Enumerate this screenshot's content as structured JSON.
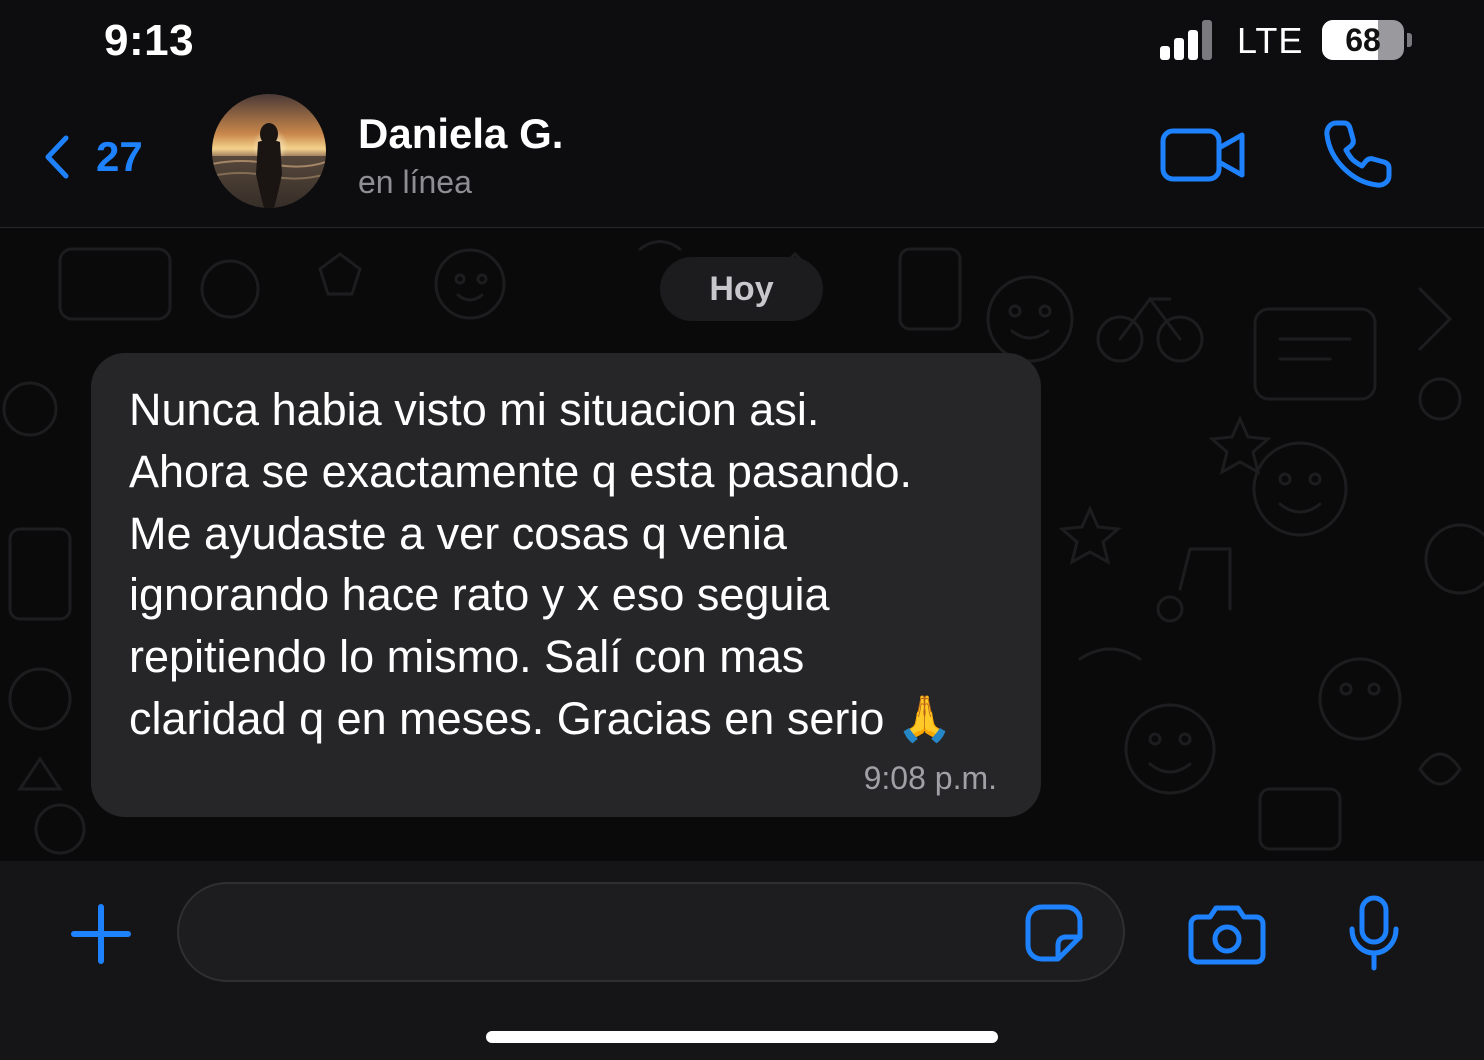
{
  "status_bar": {
    "time": "9:13",
    "network": "LTE",
    "battery": "68",
    "battery_level": 0.68
  },
  "header": {
    "back_count": "27",
    "contact_name": "Daniela G.",
    "contact_status": "en línea",
    "icons": {
      "back": "chevron-left-icon",
      "video": "video-camera-icon",
      "call": "phone-icon"
    }
  },
  "chat": {
    "date_label": "Hoy",
    "message": {
      "lines": [
        "Nunca habia visto mi situacion asi.",
        "Ahora se exactamente q esta pasando.",
        "Me ayudaste a ver cosas q venia",
        "ignorando hace rato y x eso seguia",
        "repitiendo lo mismo. Salí con mas",
        "claridad q en meses. Gracias en serio 🙏"
      ],
      "time": "9:08 p.m."
    }
  },
  "input_bar": {
    "value": "",
    "icons": {
      "attach": "plus-icon",
      "sticker": "sticker-icon",
      "camera": "camera-icon",
      "mic": "microphone-icon"
    }
  },
  "colors": {
    "accent": "#1e82ff",
    "background": "#0b0b0d",
    "bubble": "#262628",
    "secondary_text": "#8e8e93"
  }
}
